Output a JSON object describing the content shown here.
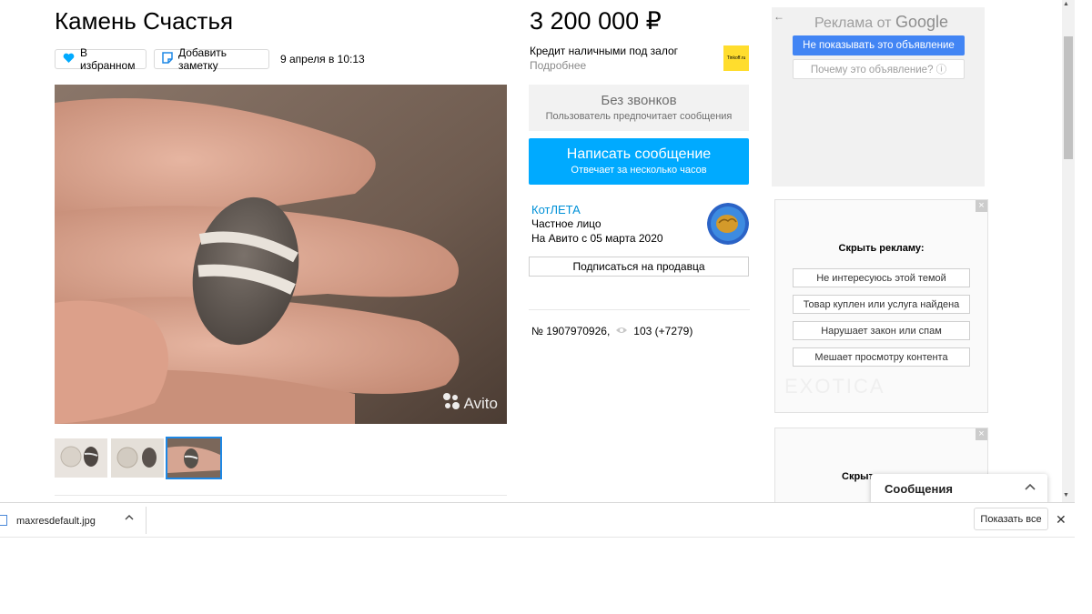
{
  "listing": {
    "title": "Камень Счастья",
    "favorite_label": "В избранном",
    "note_label": "Добавить заметку",
    "date": "9 апреля в 10:13",
    "watermark": "Avito",
    "thumbnails_selected_index": 2
  },
  "sidebar": {
    "price": "3 200 000 ₽",
    "credit_title": "Кредит наличными под залог",
    "credit_more": "Подробнее",
    "credit_logo_text": "Tinkoff.ru",
    "no_calls_title": "Без звонков",
    "no_calls_sub": "Пользователь предпочитает сообщения",
    "message_button": "Написать сообщение",
    "message_sub": "Отвечает за несколько часов",
    "seller_name": "КотЛЕТА",
    "seller_type": "Частное лицо",
    "seller_since": "На Авито с 05 марта 2020",
    "subscribe": "Подписаться на продавца",
    "ad_number": "№ 1907970926,",
    "views": "103 (+7279)"
  },
  "ads": {
    "google_label": "Реклама от",
    "google_brand": "Google",
    "hide_ad": "Не показывать это объявление",
    "why_ad": "Почему это объявление? ⓘ",
    "hide_heading": "Скрыть рекламу:",
    "options": [
      "Не интересуюсь этой темой",
      "Товар куплен или услуга найдена",
      "Нарушает закон или спам",
      "Мешает просмотру контента"
    ],
    "watermark": "EXOTICA",
    "hide_heading_short": "Скрыт",
    "messages_panel": "Сообщения"
  },
  "download_bar": {
    "file_name": "maxresdefault.jpg",
    "show_all": "Показать все"
  },
  "colors": {
    "accent": "#00aaff",
    "link": "#0091d8",
    "google_button": "#4285f4",
    "tinkoff": "#ffdd2d"
  }
}
